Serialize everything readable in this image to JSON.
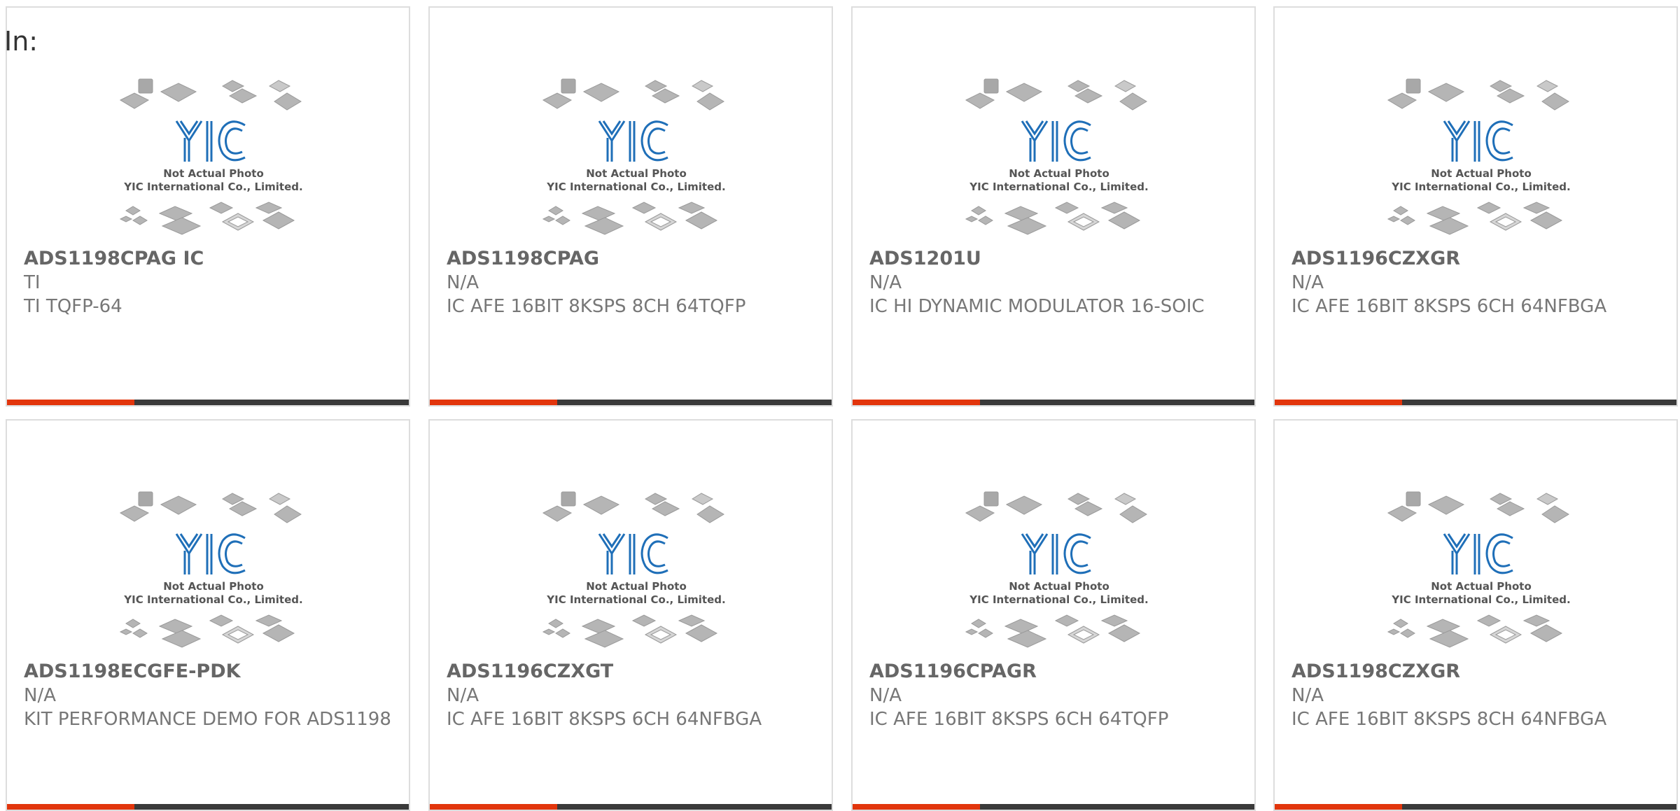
{
  "header": {
    "in_label": "In:"
  },
  "colors": {
    "accent_red": "#e2350c",
    "accent_dark": "#3a3a3a",
    "logo_blue": "#1f6fb8"
  },
  "placeholder": {
    "caption_line1": "Not Actual Photo",
    "caption_line2": "YIC International Co., Limited.",
    "logo_text": "YIC"
  },
  "products": [
    {
      "part_number": "ADS1198CPAG IC",
      "manufacturer": "TI",
      "description": "TI TQFP-64"
    },
    {
      "part_number": "ADS1198CPAG",
      "manufacturer": "N/A",
      "description": "IC AFE 16BIT 8KSPS 8CH 64TQFP"
    },
    {
      "part_number": "ADS1201U",
      "manufacturer": "N/A",
      "description": "IC HI DYNAMIC MODULATOR 16-SOIC"
    },
    {
      "part_number": "ADS1196CZXGR",
      "manufacturer": "N/A",
      "description": "IC AFE 16BIT 8KSPS 6CH 64NFBGA"
    },
    {
      "part_number": "ADS1198ECGFE-PDK",
      "manufacturer": "N/A",
      "description": "KIT PERFORMANCE DEMO FOR ADS1198"
    },
    {
      "part_number": "ADS1196CZXGT",
      "manufacturer": "N/A",
      "description": "IC AFE 16BIT 8KSPS 6CH 64NFBGA"
    },
    {
      "part_number": "ADS1196CPAGR",
      "manufacturer": "N/A",
      "description": "IC AFE 16BIT 8KSPS 6CH 64TQFP"
    },
    {
      "part_number": "ADS1198CZXGR",
      "manufacturer": "N/A",
      "description": "IC AFE 16BIT 8KSPS 8CH 64NFBGA"
    }
  ]
}
